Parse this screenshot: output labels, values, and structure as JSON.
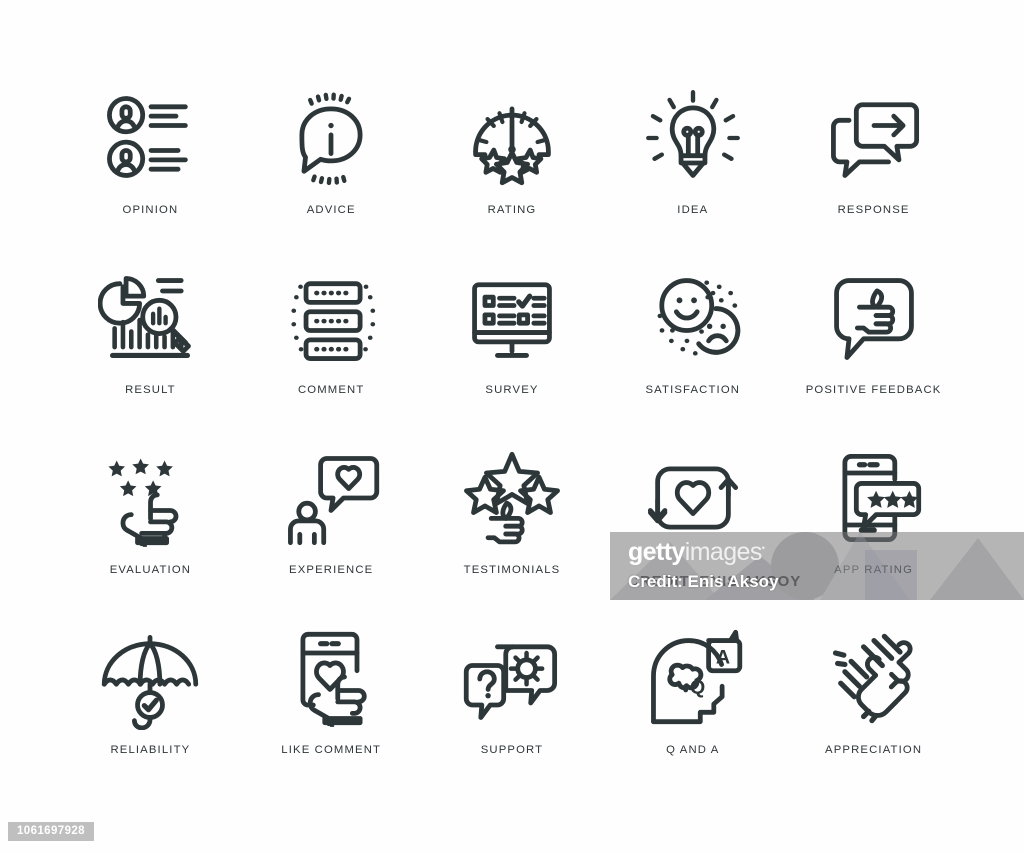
{
  "meta": {
    "stroke_color": "#2d3638",
    "background_color": "#fefefe",
    "label_color": "#2d3638"
  },
  "grid": {
    "columns": 5,
    "rows": 4,
    "icons": [
      {
        "name": "opinion-icon",
        "label": "OPINION"
      },
      {
        "name": "advice-icon",
        "label": "ADVICE"
      },
      {
        "name": "rating-icon",
        "label": "RATING"
      },
      {
        "name": "idea-icon",
        "label": "IDEA"
      },
      {
        "name": "response-icon",
        "label": "RESPONSE"
      },
      {
        "name": "result-icon",
        "label": "RESULT"
      },
      {
        "name": "comment-icon",
        "label": "COMMENT"
      },
      {
        "name": "survey-icon",
        "label": "SURVEY"
      },
      {
        "name": "satisfaction-icon",
        "label": "SATISFACTION"
      },
      {
        "name": "positive-feedback-icon",
        "label": "POSITIVE FEEDBACK"
      },
      {
        "name": "evaluation-icon",
        "label": "EVALUATION"
      },
      {
        "name": "experience-icon",
        "label": "EXPERIENCE"
      },
      {
        "name": "testimonials-icon",
        "label": "TESTIMONIALS"
      },
      {
        "name": "share-love-icon",
        "label": ""
      },
      {
        "name": "app-rating-icon",
        "label": "APP RATING"
      },
      {
        "name": "reliability-icon",
        "label": "RELIABILITY"
      },
      {
        "name": "like-comment-icon",
        "label": "LIKE COMMENT"
      },
      {
        "name": "support-icon",
        "label": "SUPPORT"
      },
      {
        "name": "q-and-a-icon",
        "label": "Q AND A"
      },
      {
        "name": "appreciation-icon",
        "label": "APPRECIATION"
      }
    ]
  },
  "watermark": {
    "brand_bold": "getty",
    "brand_light": "images",
    "brand_mark": "•",
    "credit": "Credit: Enis Aksoy",
    "credit_ghost": "CREDIT: ENIS AKSOY"
  },
  "id_badge": {
    "value": "1061697928"
  }
}
